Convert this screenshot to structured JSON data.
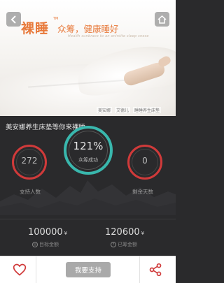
{
  "hero": {
    "logo": "裸睡",
    "logo_mark": "TM",
    "slogan": "众筹，健康睡好",
    "sub_slogan": "Health sunbrace to an onintite sleep snese",
    "brand_tags": [
      "美安娜",
      "艾德儿",
      "睡睡养生床垫"
    ]
  },
  "caption": "美安娜养生床垫等你来裸睡",
  "stats": {
    "supporters": {
      "value": "272",
      "label": "支持人数"
    },
    "progress": {
      "value": "121%",
      "label": "众筹成功",
      "fraction": 1.21
    },
    "days_left": {
      "value": "0",
      "label": "剩余天数"
    }
  },
  "amounts": {
    "target": {
      "value": "100000",
      "unit": "¥",
      "label": "目标金额"
    },
    "raised": {
      "value": "120600",
      "unit": "¥",
      "label": "已筹金额"
    }
  },
  "bottom_bar": {
    "support_label": "我要支持"
  },
  "colors": {
    "accent_orange": "#e8793a",
    "ring_red": "#d03a3a",
    "ring_teal": "#39b7ad",
    "background": "#2a2a2c"
  },
  "icons": {
    "back": "chevron-left-icon",
    "home": "home-icon",
    "like": "heart-icon",
    "share": "share-icon"
  }
}
